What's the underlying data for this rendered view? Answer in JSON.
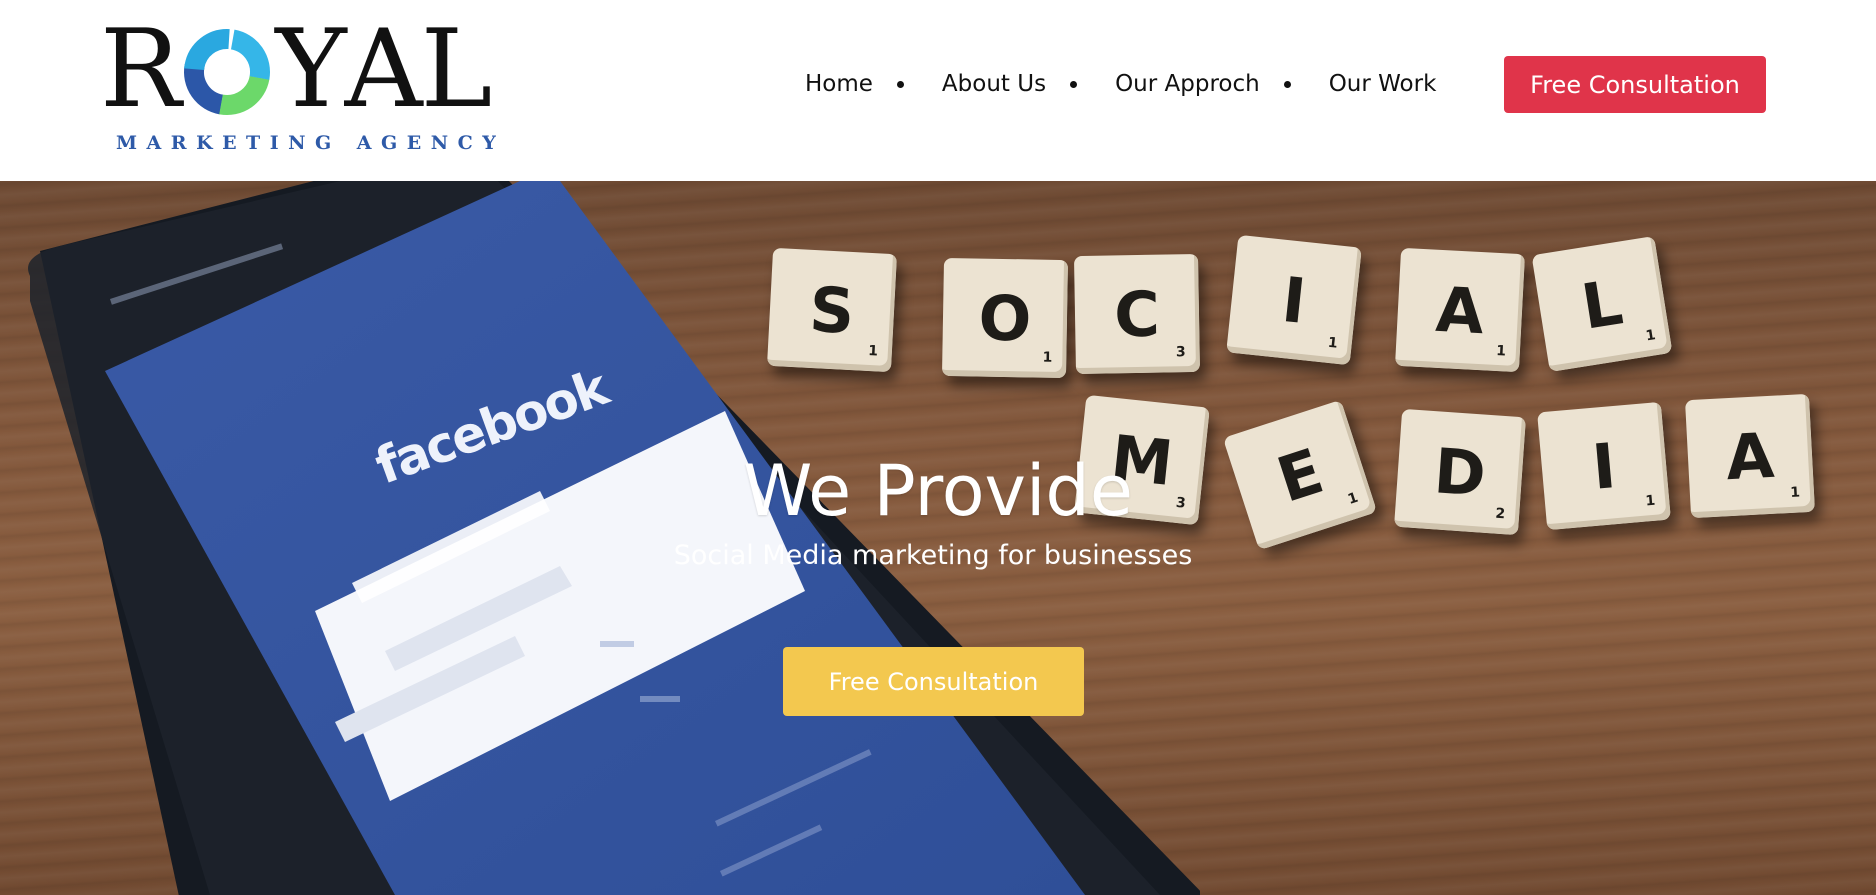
{
  "brand": {
    "logo_word": [
      "R",
      "Y",
      "A",
      "L"
    ],
    "logo_tagline": "MARKETING AGENCY",
    "logo_ring_colors": [
      "#2aa8e0",
      "#35b6e8",
      "#6cd86a",
      "#2c57a8"
    ]
  },
  "nav": {
    "items": [
      {
        "label": "Home"
      },
      {
        "label": "About Us"
      },
      {
        "label": "Our Approch"
      },
      {
        "label": "Our Work"
      }
    ],
    "cta_label": "Free Consultation"
  },
  "hero": {
    "title": "We Provide",
    "subtitle": "Social Media marketing for businesses",
    "cta_label": "Free Consultation",
    "phone_brand": "facebook",
    "tiles_row1": [
      "S",
      "O",
      "C",
      "I",
      "A",
      "L"
    ],
    "tiles_row2": [
      "M",
      "E",
      "D",
      "I",
      "A"
    ]
  },
  "colors": {
    "nav_cta": "#e0344a",
    "hero_cta": "#f3c84f",
    "tagline": "#2e5aa8"
  }
}
